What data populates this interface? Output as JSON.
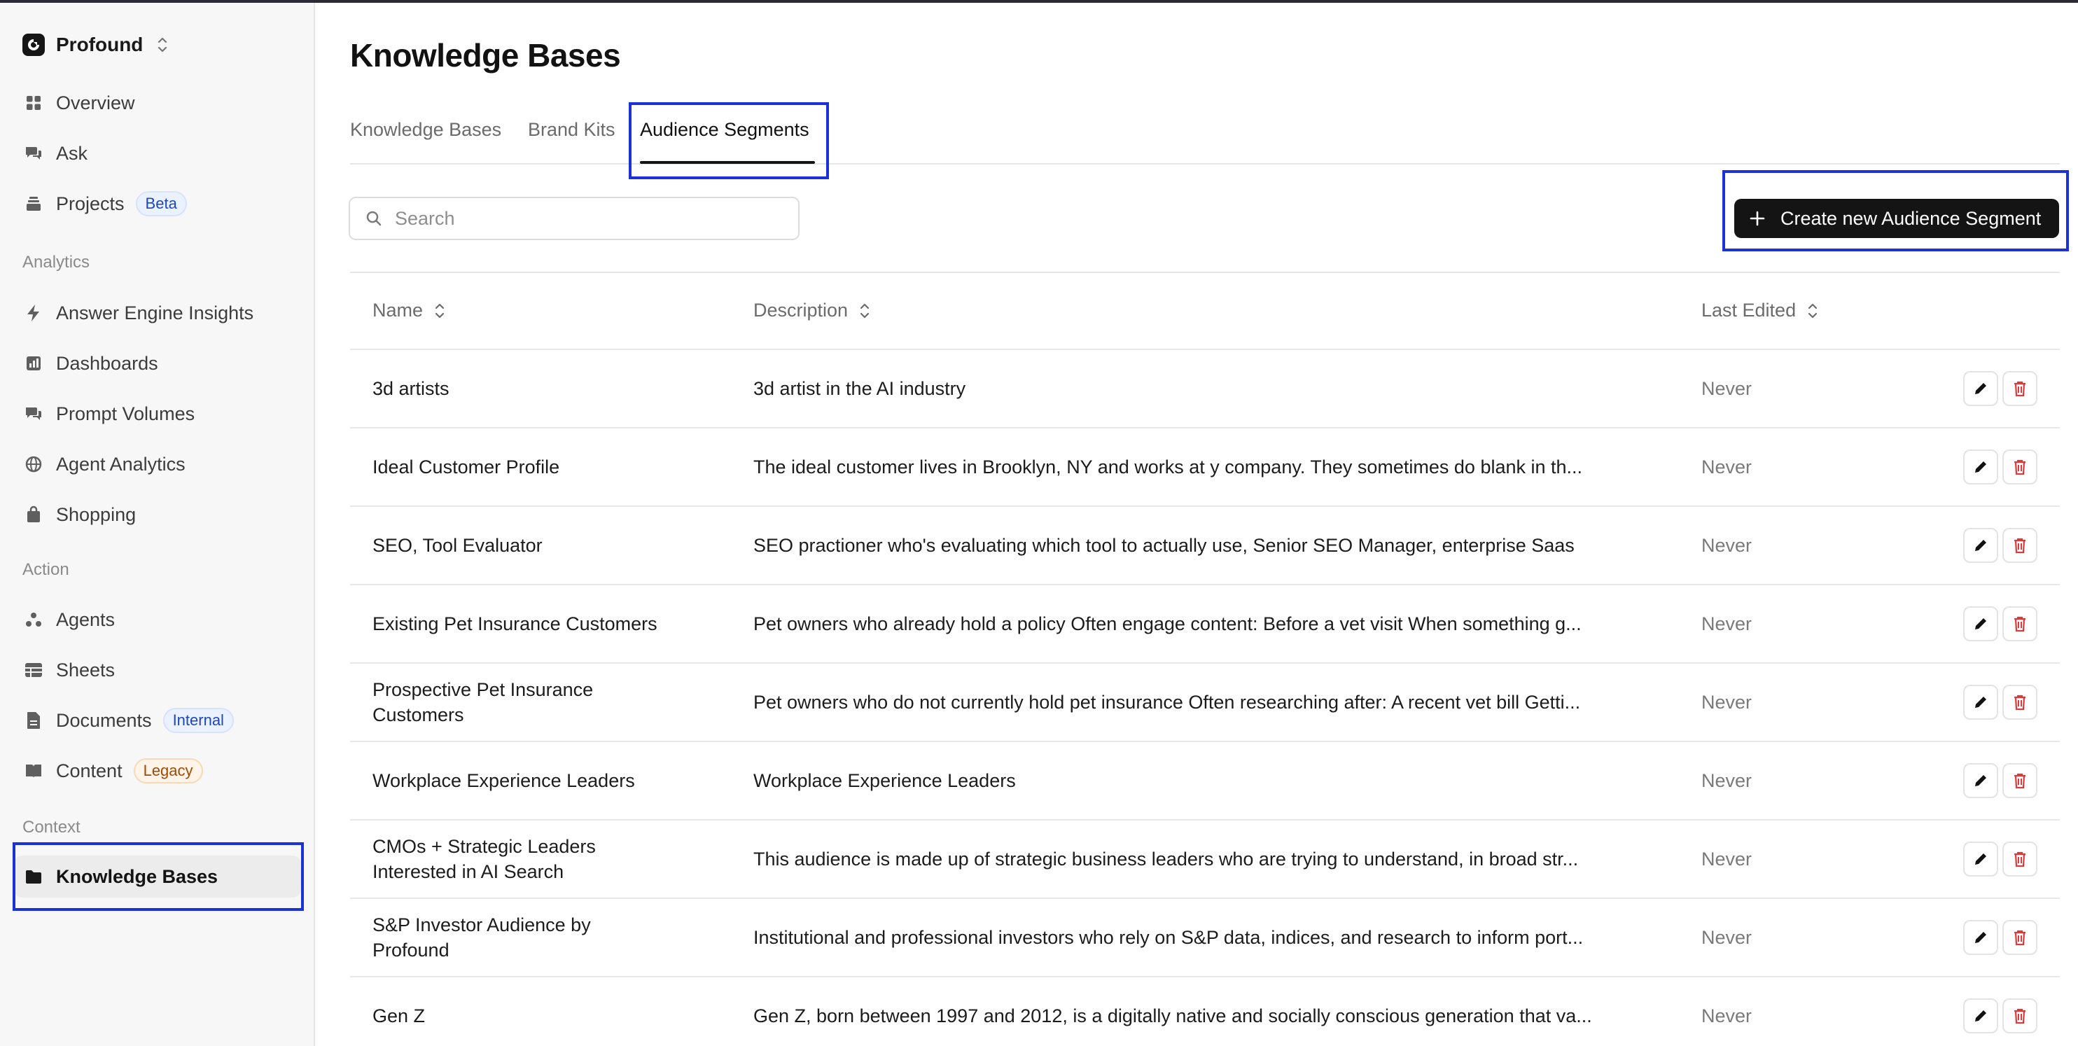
{
  "org": {
    "name": "Profound"
  },
  "nav": {
    "overview": "Overview",
    "ask": "Ask",
    "projects": "Projects",
    "projects_badge": "Beta",
    "analytics_label": "Analytics",
    "answer_engine_insights": "Answer Engine Insights",
    "dashboards": "Dashboards",
    "prompt_volumes": "Prompt Volumes",
    "agent_analytics": "Agent Analytics",
    "shopping": "Shopping",
    "action_label": "Action",
    "agents": "Agents",
    "sheets": "Sheets",
    "documents": "Documents",
    "documents_badge": "Internal",
    "content": "Content",
    "content_badge": "Legacy",
    "context_label": "Context",
    "knowledge_bases": "Knowledge Bases"
  },
  "page": {
    "title": "Knowledge Bases"
  },
  "tabs": [
    "Knowledge Bases",
    "Brand Kits",
    "Audience Segments"
  ],
  "search": {
    "placeholder": "Search"
  },
  "create_button": "Create new Audience Segment",
  "table": {
    "headers": [
      "Name",
      "Description",
      "Last Edited"
    ],
    "rows": [
      {
        "name": "3d artists",
        "description": "3d artist in the AI industry",
        "last_edited": "Never"
      },
      {
        "name": "Ideal Customer Profile",
        "description": "The ideal customer lives in Brooklyn, NY and works at y company. They sometimes do blank in th...",
        "last_edited": "Never"
      },
      {
        "name": "SEO, Tool Evaluator",
        "description": "SEO practioner who's evaluating which tool to actually use, Senior SEO Manager, enterprise Saas",
        "last_edited": "Never"
      },
      {
        "name": "Existing Pet Insurance Customers",
        "description": "Pet owners who already hold a policy Often engage content: Before a vet visit When something g...",
        "last_edited": "Never"
      },
      {
        "name": "Prospective Pet Insurance Customers",
        "description": "Pet owners who do not currently hold pet insurance Often researching after: A recent vet bill Getti...",
        "last_edited": "Never"
      },
      {
        "name": "Workplace Experience Leaders",
        "description": "Workplace Experience Leaders",
        "last_edited": "Never"
      },
      {
        "name": "CMOs + Strategic Leaders Interested in AI Search",
        "description": "This audience is made up of strategic business leaders who are trying to understand, in broad str...",
        "last_edited": "Never"
      },
      {
        "name": "S&P Investor Audience by Profound",
        "description": "Institutional and professional investors who rely on S&P data, indices, and research to inform port...",
        "last_edited": "Never"
      },
      {
        "name": "Gen Z",
        "description": "Gen Z, born between 1997 and 2012, is a digitally native and socially conscious generation that va...",
        "last_edited": "Never"
      }
    ]
  },
  "colors": {
    "accent": "#141414",
    "highlight": "#1a32d8",
    "danger": "#d93a3a"
  }
}
